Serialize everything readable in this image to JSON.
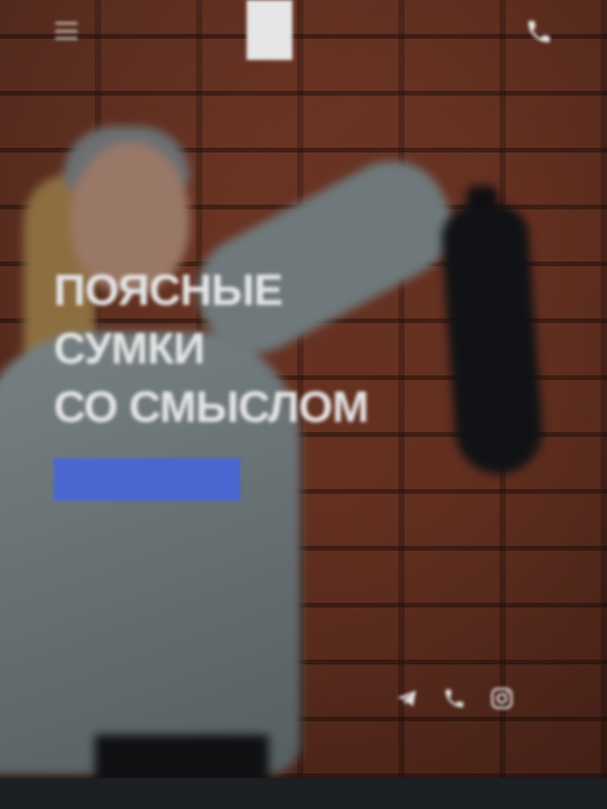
{
  "header": {
    "logo_box_text": "",
    "logo_text": "",
    "phone_icon": "phone-icon",
    "menu_icon": "menu-icon"
  },
  "hero": {
    "headline_line1": "ПОЯСНЫЕ СУМКИ",
    "headline_line2": "СО СМЫСЛОМ",
    "subtitle": "",
    "cta_label": "",
    "cta_color": "#4a67d2"
  },
  "social": [
    {
      "icon": "telegram-icon"
    },
    {
      "icon": "phone-icon"
    },
    {
      "icon": "instagram-icon"
    }
  ],
  "colors": {
    "brick": "#7a3a25",
    "footer": "#1c1f23",
    "accent": "#4a67d2"
  }
}
